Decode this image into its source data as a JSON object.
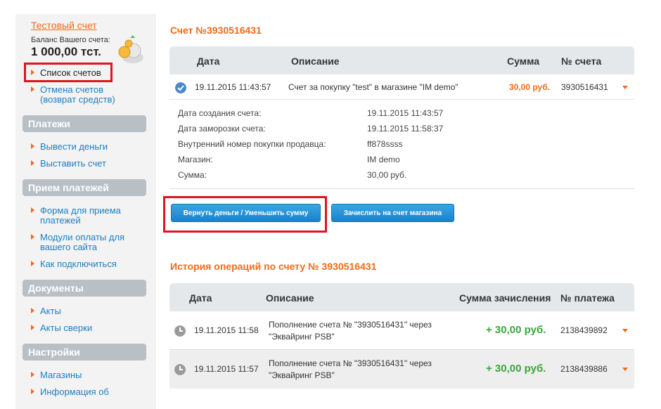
{
  "sidebar": {
    "account_title": "Тестовый счет",
    "balance_label": "Баланс Вашего счета:",
    "balance_value": "1 000,00 тст.",
    "links_top": [
      {
        "label": "Список счетов"
      },
      {
        "label": "Отмена счетов (возврат средств)"
      }
    ],
    "sections": [
      {
        "title": "Платежи",
        "items": [
          "Вывести деньги",
          "Выставить счет"
        ]
      },
      {
        "title": "Прием платежей",
        "items": [
          "Форма для приема платежей",
          "Модули оплаты для вашего сайта",
          "Как подключиться"
        ]
      },
      {
        "title": "Документы",
        "items": [
          "Акты",
          "Акты сверки"
        ]
      },
      {
        "title": "Настройки",
        "items": [
          "Магазины",
          "Информация об"
        ]
      }
    ]
  },
  "invoice": {
    "title": "Счет №3930516431",
    "columns": {
      "date": "Дата",
      "desc": "Описание",
      "sum": "Сумма",
      "num": "№ счета"
    },
    "row": {
      "date": "19.11.2015 11:43:57",
      "desc": "Счет за покупку \"test\" в магазине \"IM demo\"",
      "sum": "30,00 руб.",
      "num": "3930516431"
    },
    "details": [
      {
        "label": "Дата создания счета:",
        "value": "19.11.2015 11:43:57"
      },
      {
        "label": "Дата заморозки счета:",
        "value": "19.11.2015 11:58:37"
      },
      {
        "label": "Внутренний номер покупки продавца:",
        "value": "ff878ssss"
      },
      {
        "label": "Магазин:",
        "value": "IM demo"
      },
      {
        "label": "Сумма:",
        "value": "30,00 руб."
      }
    ],
    "btn_refund": "Вернуть деньги / Уменьшить сумму",
    "btn_credit": "Зачислить на счет магазина"
  },
  "history": {
    "title": "История операций по счету № 3930516431",
    "columns": {
      "date": "Дата",
      "desc": "Описание",
      "sum": "Сумма зачисления",
      "num": "№ платежа"
    },
    "rows": [
      {
        "date": "19.11.2015 11:58",
        "desc1": "Пополнение счета № \"3930516431\" через",
        "desc2": "\"Эквайринг PSB\"",
        "sum": "+ 30,00 руб.",
        "num": "2138439892"
      },
      {
        "date": "19.11.2015 11:57",
        "desc1": "Пополнение счета № \"3930516431\" через",
        "desc2": "\"Эквайринг PSB\"",
        "sum": "+ 30,00 руб.",
        "num": "2138439886"
      }
    ]
  },
  "colors": {
    "accent": "#f26a1b",
    "link": "#1a7fc1",
    "highlight": "#e0141e",
    "positive": "#3aa63a"
  }
}
